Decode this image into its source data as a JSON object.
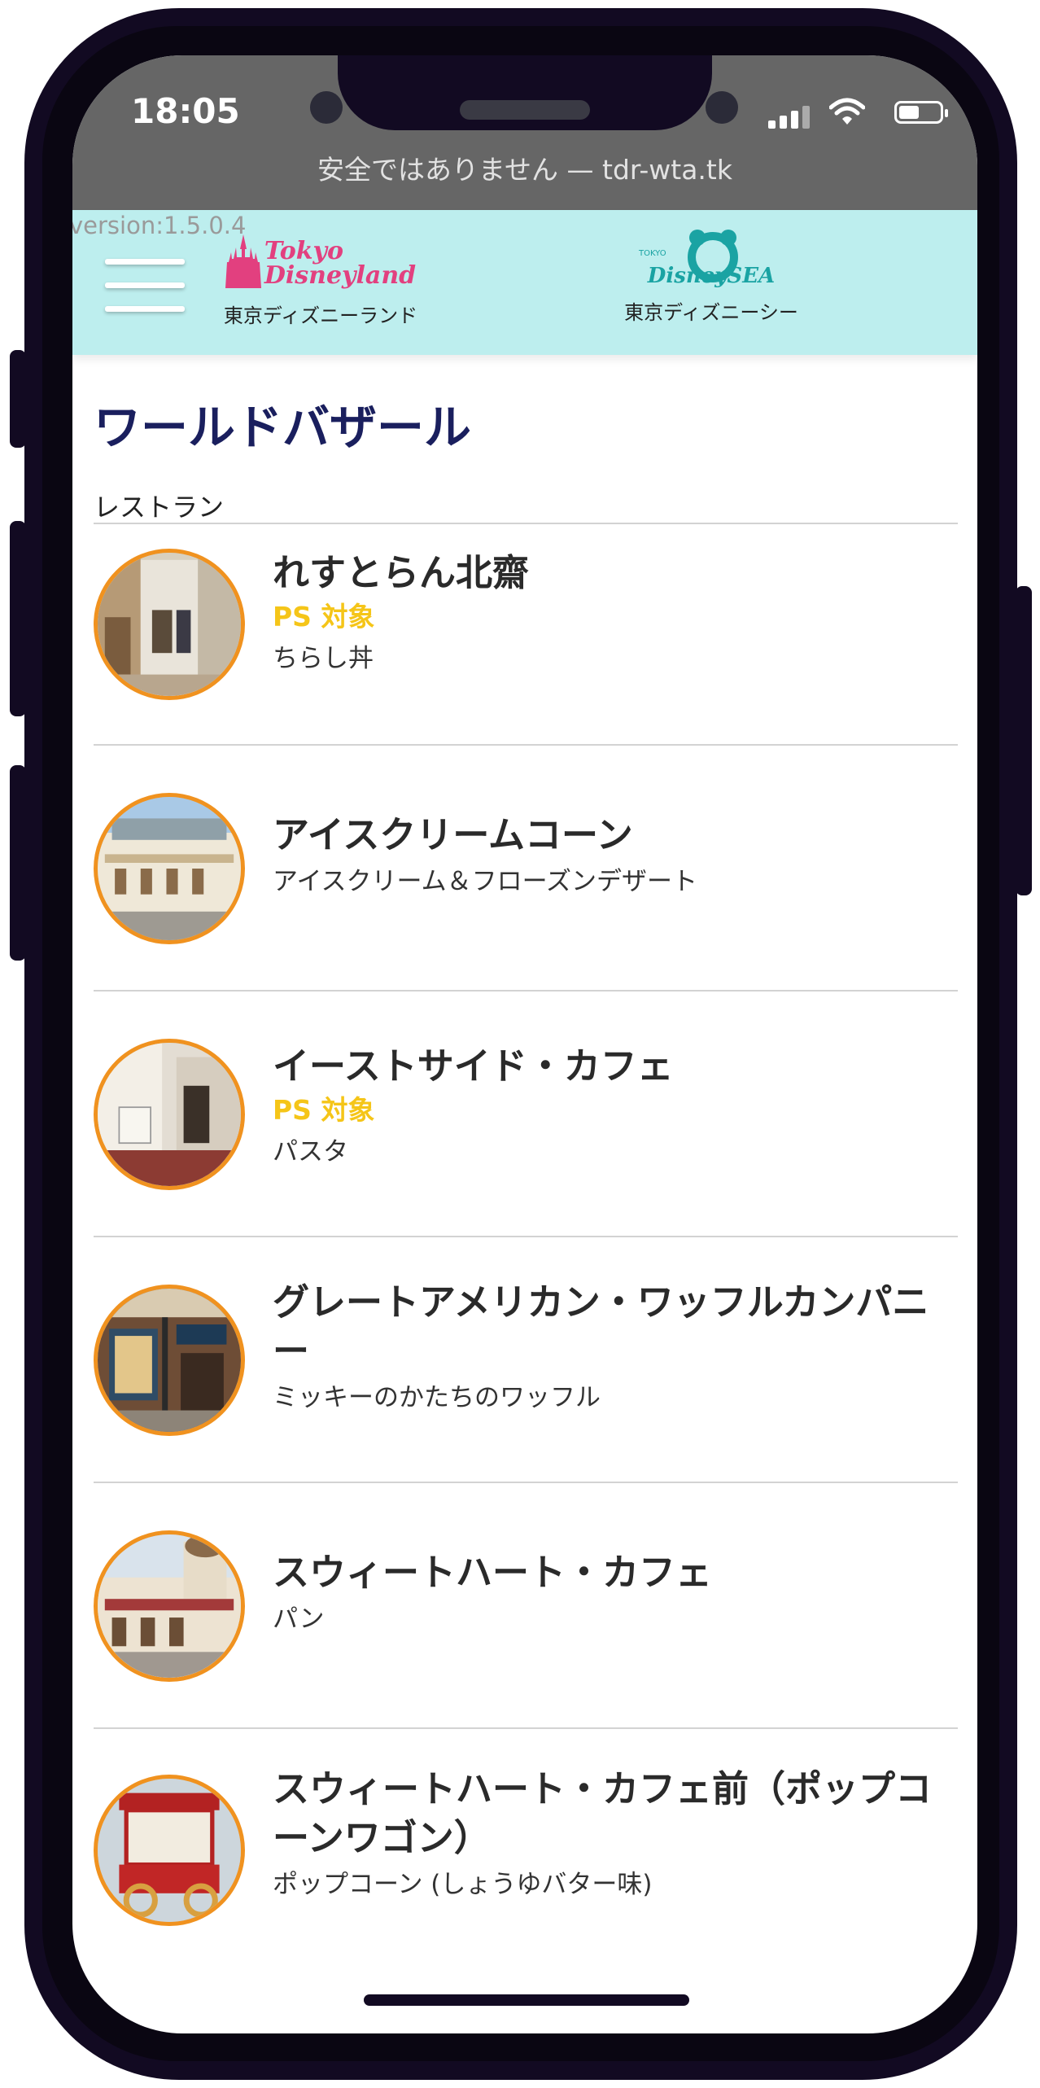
{
  "status_bar": {
    "time": "18:05",
    "url_text": "安全ではありません — tdr-wta.tk"
  },
  "header": {
    "version": "version:1.5.0.4",
    "parks": [
      {
        "logo_text_1": "Tokyo",
        "logo_text_2": "Disneyland",
        "label": "東京ディズニーランド"
      },
      {
        "logo_text_top": "TOKYO",
        "logo_text": "DisneySEA",
        "label": "東京ディズニーシー"
      }
    ]
  },
  "page": {
    "title": "ワールドバザール",
    "section": "レストラン"
  },
  "colors": {
    "accent_ring": "#f0921f",
    "ps_badge": "#f5c518",
    "header_bg": "#bdeeee",
    "title": "#1a1f5e"
  },
  "restaurants": [
    {
      "name": "れすとらん北齋",
      "ps": "PS 対象",
      "desc": "ちらし丼"
    },
    {
      "name": "アイスクリームコーン",
      "ps": "",
      "desc": "アイスクリーム＆フローズンデザート"
    },
    {
      "name": "イーストサイド・カフェ",
      "ps": "PS 対象",
      "desc": "パスタ"
    },
    {
      "name": "グレートアメリカン・ワッフルカンパニー",
      "ps": "",
      "desc": "ミッキーのかたちのワッフル"
    },
    {
      "name": "スウィートハート・カフェ",
      "ps": "",
      "desc": "パン"
    },
    {
      "name": "スウィートハート・カフェ前（ポップコーンワゴン）",
      "ps": "",
      "desc": "ポップコーン (しょうゆバター味)"
    }
  ]
}
